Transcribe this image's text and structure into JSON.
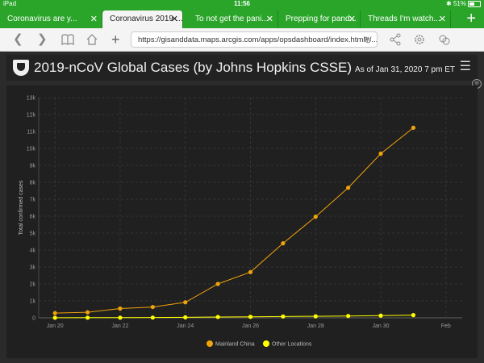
{
  "status_bar": {
    "device": "iPad",
    "time": "11:56",
    "battery": "51%"
  },
  "tabs": [
    {
      "label": "Coronavirus are y..."
    },
    {
      "label": "Coronavirus 2019-..."
    },
    {
      "label": "To not get the pani..."
    },
    {
      "label": "Prepping for pand..."
    },
    {
      "label": "Threads I'm watch..."
    }
  ],
  "active_tab": 1,
  "toolbar": {
    "url": "https://gisanddata.maps.arcgis.com/apps/opsdashboard/index.html#/..."
  },
  "dashboard": {
    "title": "2019-nCoV Global Cases (by Johns Hopkins CSSE)",
    "subtitle": "As of Jan 31, 2020 7 pm ET"
  },
  "colors": {
    "browser_green": "#2aa52a",
    "mainland_china": "#f0a30a",
    "other_locations": "#ffff00"
  },
  "chart_data": {
    "type": "line",
    "ylabel": "Total confirmed cases",
    "ylim": [
      0,
      13000
    ],
    "yticks": [
      0,
      1000,
      2000,
      3000,
      4000,
      5000,
      6000,
      7000,
      8000,
      9000,
      10000,
      11000,
      12000,
      13000
    ],
    "ytick_labels": [
      "0",
      "1k",
      "2k",
      "3k",
      "4k",
      "5k",
      "6k",
      "7k",
      "8k",
      "9k",
      "10k",
      "11k",
      "12k",
      "13k"
    ],
    "x": [
      "2020-01-20",
      "2020-01-21",
      "2020-01-22",
      "2020-01-23",
      "2020-01-24",
      "2020-01-25",
      "2020-01-26",
      "2020-01-27",
      "2020-01-28",
      "2020-01-29",
      "2020-01-30",
      "2020-01-31"
    ],
    "xlim": [
      "2020-01-19T12:00",
      "2020-02-01T12:00"
    ],
    "xticks": [
      {
        "date": "2020-01-20",
        "label": "Jan 20"
      },
      {
        "date": "2020-01-22",
        "label": "Jan 22"
      },
      {
        "date": "2020-01-24",
        "label": "Jan 24"
      },
      {
        "date": "2020-01-26",
        "label": "Jan 26"
      },
      {
        "date": "2020-01-28",
        "label": "Jan 28"
      },
      {
        "date": "2020-01-30",
        "label": "Jan 30"
      },
      {
        "date": "2020-02-01",
        "label": "Feb"
      }
    ],
    "series": [
      {
        "name": "Mainland China",
        "color": "#f0a30a",
        "values": [
          278,
          326,
          547,
          639,
          916,
          2000,
          2700,
          4400,
          5970,
          7680,
          9690,
          11220
        ]
      },
      {
        "name": "Other Locations",
        "color": "#ffff00",
        "values": [
          4,
          9,
          10,
          15,
          30,
          50,
          60,
          80,
          90,
          110,
          130,
          160
        ]
      }
    ],
    "grid": true,
    "legend_position": "bottom-center"
  }
}
